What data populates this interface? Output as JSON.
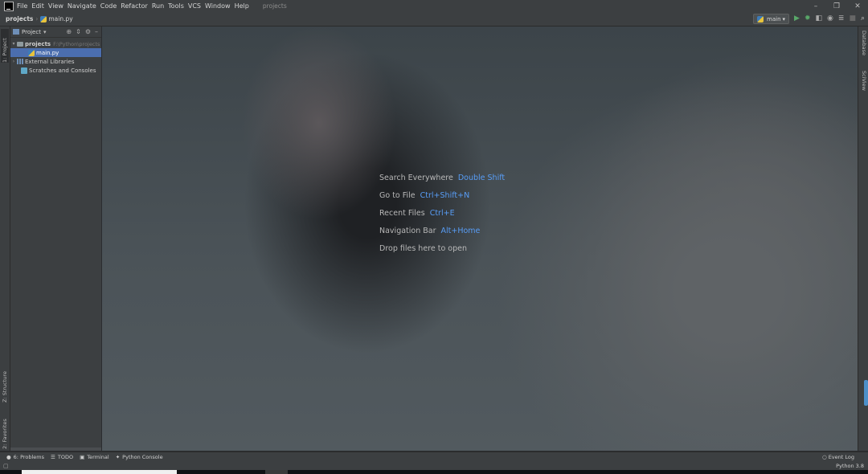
{
  "menu": {
    "items": [
      "File",
      "Edit",
      "View",
      "Navigate",
      "Code",
      "Refactor",
      "Run",
      "Tools",
      "VCS",
      "Window",
      "Help"
    ],
    "window_title": "projects"
  },
  "navbar": {
    "crumbs": [
      "projects",
      "main.py"
    ],
    "run_config": "main"
  },
  "left_tabs": {
    "project": "1: Project",
    "structure": "Z: Structure",
    "favorites": "2: Favorites"
  },
  "right_tabs": {
    "database": "Database",
    "sciview": "SciView"
  },
  "project_panel": {
    "title": "Project",
    "tree": {
      "root": "projects",
      "root_path": "F:\\Python\\projects",
      "file": "main.py",
      "libraries": "External Libraries",
      "scratches": "Scratches and Consoles"
    }
  },
  "editor": {
    "hints": [
      {
        "label": "Search Everywhere",
        "shortcut": "Double Shift"
      },
      {
        "label": "Go to File",
        "shortcut": "Ctrl+Shift+N"
      },
      {
        "label": "Recent Files",
        "shortcut": "Ctrl+E"
      },
      {
        "label": "Navigation Bar",
        "shortcut": "Alt+Home"
      },
      {
        "label": "Drop files here to open",
        "shortcut": ""
      }
    ]
  },
  "bottom_tools": {
    "problems": "6: Problems",
    "todo": "TODO",
    "terminal": "Terminal",
    "python_console": "Python Console",
    "event_log": "Event Log"
  },
  "status": {
    "interpreter": "Python 3.8"
  },
  "colors": {
    "accent": "#589df6",
    "selection": "#4b6eaf",
    "panel_bg": "#3c3f41"
  }
}
